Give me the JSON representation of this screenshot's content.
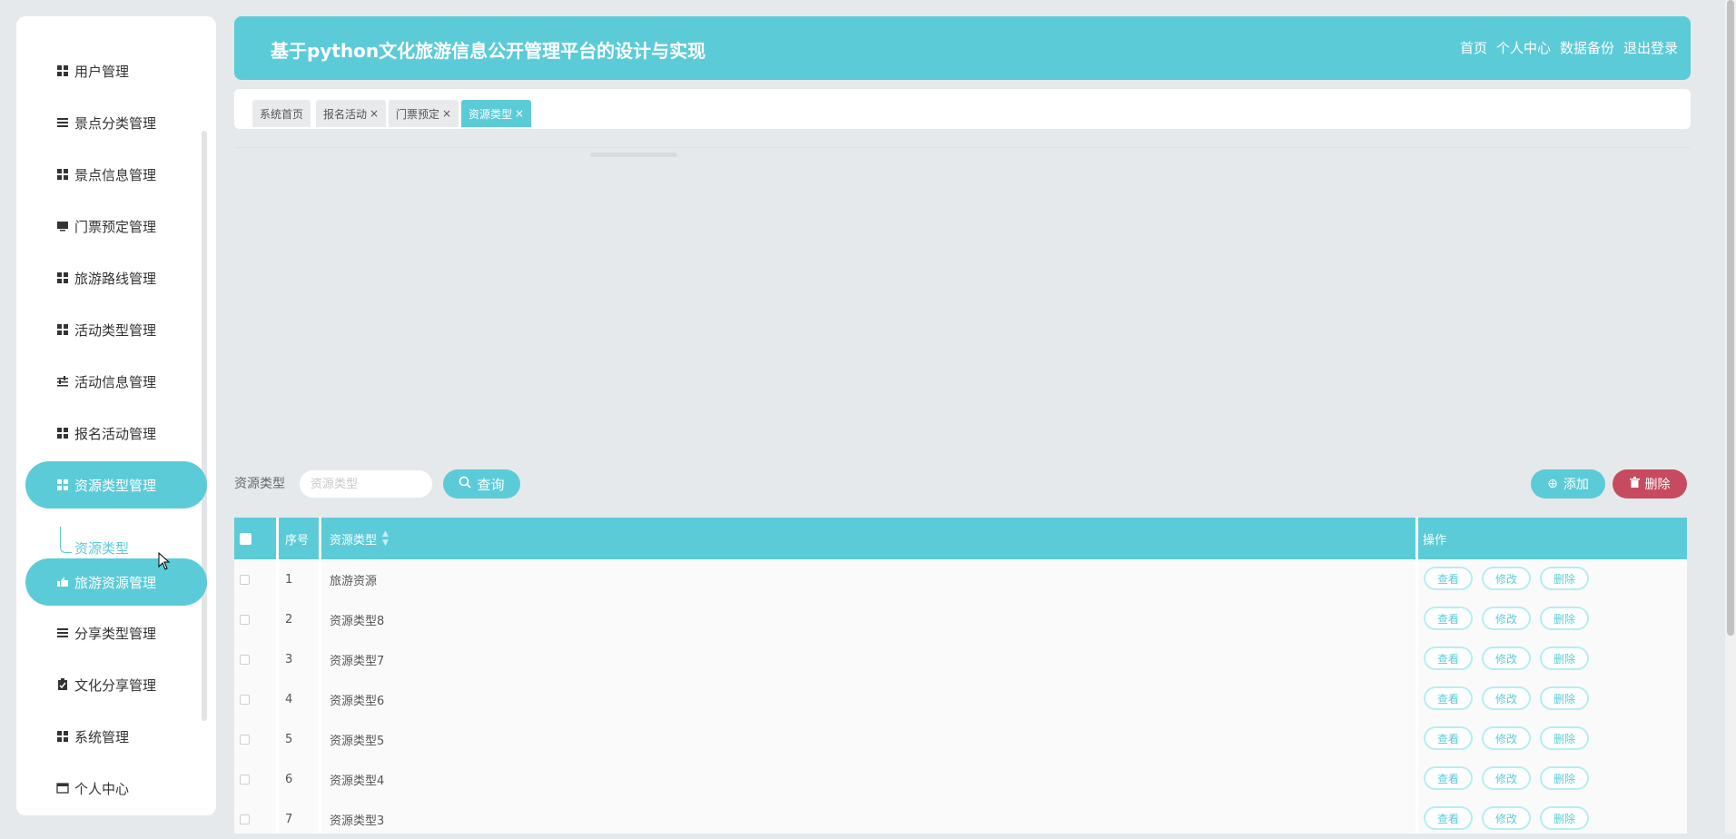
{
  "header": {
    "title": "基于python文化旅游信息公开管理平台的设计与实现",
    "links": [
      "首页",
      "个人中心",
      "数据备份",
      "退出登录"
    ]
  },
  "sidebar": {
    "items": [
      {
        "label": "用户管理",
        "icon": "grid-icon"
      },
      {
        "label": "景点分类管理",
        "icon": "list-icon"
      },
      {
        "label": "景点信息管理",
        "icon": "grid-icon"
      },
      {
        "label": "门票预定管理",
        "icon": "monitor-icon"
      },
      {
        "label": "旅游路线管理",
        "icon": "grid-icon"
      },
      {
        "label": "活动类型管理",
        "icon": "grid-icon"
      },
      {
        "label": "活动信息管理",
        "icon": "sliders-icon"
      },
      {
        "label": "报名活动管理",
        "icon": "grid-icon"
      },
      {
        "label": "资源类型管理",
        "icon": "grid-icon",
        "active": true
      },
      {
        "label": "旅游资源管理",
        "icon": "thumbs-up-icon",
        "active": true
      },
      {
        "label": "分享类型管理",
        "icon": "list-icon"
      },
      {
        "label": "文化分享管理",
        "icon": "clipboard-icon"
      },
      {
        "label": "系统管理",
        "icon": "grid-icon"
      },
      {
        "label": "个人中心",
        "icon": "window-icon"
      }
    ],
    "sub_item": "资源类型"
  },
  "tabs": [
    {
      "label": "系统首页",
      "closable": false
    },
    {
      "label": "报名活动",
      "closable": true
    },
    {
      "label": "门票预定",
      "closable": true
    },
    {
      "label": "资源类型",
      "closable": true,
      "active": true
    }
  ],
  "search": {
    "label": "资源类型",
    "placeholder": "资源类型",
    "query_button": "查询",
    "add_button": "添加",
    "delete_button": "删除"
  },
  "table": {
    "headers": {
      "index": "序号",
      "type": "资源类型",
      "ops": "操作"
    },
    "rows": [
      {
        "index": "1",
        "type": "旅游资源"
      },
      {
        "index": "2",
        "type": "资源类型8"
      },
      {
        "index": "3",
        "type": "资源类型7"
      },
      {
        "index": "4",
        "type": "资源类型6"
      },
      {
        "index": "5",
        "type": "资源类型5"
      },
      {
        "index": "6",
        "type": "资源类型4"
      },
      {
        "index": "7",
        "type": "资源类型3"
      }
    ],
    "ops": [
      "查看",
      "修改",
      "删除"
    ]
  },
  "colors": {
    "accent": "#5ccbd8",
    "danger": "#c74b60"
  }
}
